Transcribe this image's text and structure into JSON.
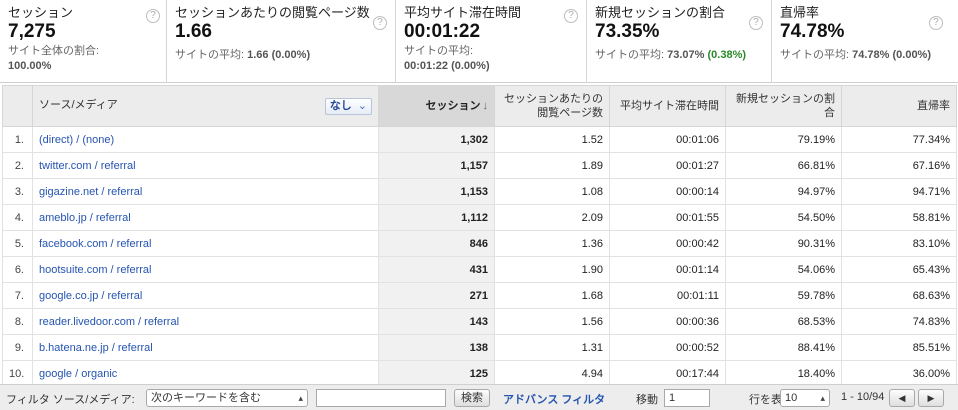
{
  "summary": [
    {
      "name": "セッション",
      "value": "7,275",
      "sub1": "サイト全体の割合:",
      "sub2": "100.00%"
    },
    {
      "name": "セッションあたりの閲覧ページ数",
      "value": "1.66",
      "sub1": "サイトの平均: ",
      "sub1b": "1.66 (0.00%)"
    },
    {
      "name": "平均サイト滞在時間",
      "value": "00:01:22",
      "sub1": "サイトの平均:",
      "sub2": "00:01:22 (0.00%)"
    },
    {
      "name": "新規セッションの割合",
      "value": "73.35%",
      "sub1": "サイトの平均: ",
      "sub1b": "73.07%",
      "sub1c": " (0.38%)"
    },
    {
      "name": "直帰率",
      "value": "74.78%",
      "sub1": "サイトの平均: ",
      "sub1b": "74.78% (0.00%)"
    }
  ],
  "help_glyph": "?",
  "table": {
    "headers": {
      "source": "ソース/メディア",
      "secondary": "なし",
      "sessions": "セッション",
      "pps": "セッションあたりの閲覧ページ数",
      "duration": "平均サイト滞在時間",
      "newpct": "新規セッションの割合",
      "bounce": "直帰率"
    },
    "rows": [
      {
        "idx": "1.",
        "src": "(direct) / (none)",
        "sess": "1,302",
        "pps": "1.52",
        "dur": "00:01:06",
        "newp": "79.19%",
        "bounce": "77.34%"
      },
      {
        "idx": "2.",
        "src": "twitter.com / referral",
        "sess": "1,157",
        "pps": "1.89",
        "dur": "00:01:27",
        "newp": "66.81%",
        "bounce": "67.16%"
      },
      {
        "idx": "3.",
        "src": "gigazine.net / referral",
        "sess": "1,153",
        "pps": "1.08",
        "dur": "00:00:14",
        "newp": "94.97%",
        "bounce": "94.71%"
      },
      {
        "idx": "4.",
        "src": "ameblo.jp / referral",
        "sess": "1,112",
        "pps": "2.09",
        "dur": "00:01:55",
        "newp": "54.50%",
        "bounce": "58.81%"
      },
      {
        "idx": "5.",
        "src": "facebook.com / referral",
        "sess": "846",
        "pps": "1.36",
        "dur": "00:00:42",
        "newp": "90.31%",
        "bounce": "83.10%"
      },
      {
        "idx": "6.",
        "src": "hootsuite.com / referral",
        "sess": "431",
        "pps": "1.90",
        "dur": "00:01:14",
        "newp": "54.06%",
        "bounce": "65.43%"
      },
      {
        "idx": "7.",
        "src": "google.co.jp / referral",
        "sess": "271",
        "pps": "1.68",
        "dur": "00:01:11",
        "newp": "59.78%",
        "bounce": "68.63%"
      },
      {
        "idx": "8.",
        "src": "reader.livedoor.com / referral",
        "sess": "143",
        "pps": "1.56",
        "dur": "00:00:36",
        "newp": "68.53%",
        "bounce": "74.83%"
      },
      {
        "idx": "9.",
        "src": "b.hatena.ne.jp / referral",
        "sess": "138",
        "pps": "1.31",
        "dur": "00:00:52",
        "newp": "88.41%",
        "bounce": "85.51%"
      },
      {
        "idx": "10.",
        "src": "google / organic",
        "sess": "125",
        "pps": "4.94",
        "dur": "00:17:44",
        "newp": "18.40%",
        "bounce": "36.00%"
      }
    ]
  },
  "filter": {
    "label": "フィルタ ソース/メディア:",
    "mode": "次のキーワードを含む",
    "search": "検索",
    "advanced": "アドバンス フィルタ",
    "goto_label": "移動",
    "goto_value": "1",
    "rows_label": "行を表示:",
    "rows_value": "10",
    "range": "1 - 10/94"
  }
}
